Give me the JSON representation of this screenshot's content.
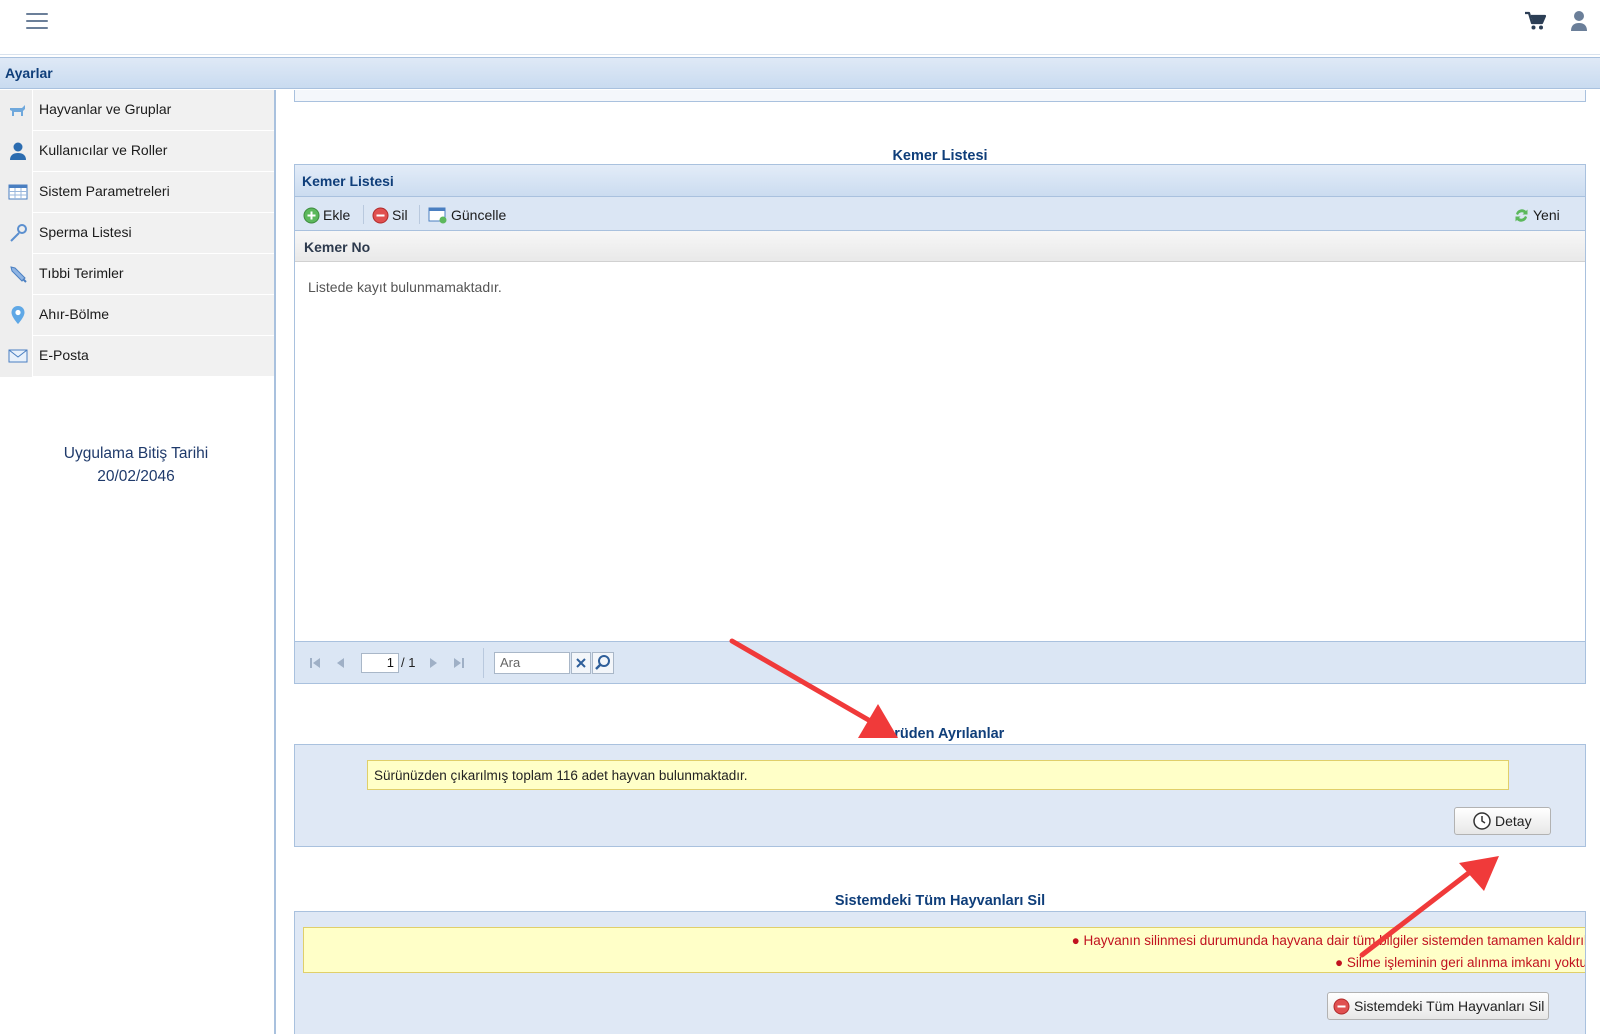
{
  "topbar": {
    "menu_icon": "hamburger-icon",
    "cart_icon": "shopping-cart-icon",
    "user_icon": "user-icon"
  },
  "settings_header": "Ayarlar",
  "sidebar": {
    "items": [
      {
        "label": "Hayvanlar ve Gruplar",
        "icon": "animal-icon"
      },
      {
        "label": "Kullanıcılar ve Roller",
        "icon": "user-icon"
      },
      {
        "label": "Sistem Parametreleri",
        "icon": "table-icon"
      },
      {
        "label": "Sperma Listesi",
        "icon": "pipette-icon"
      },
      {
        "label": "Tıbbi Terimler",
        "icon": "syringe-icon"
      },
      {
        "label": "Ahır-Bölme",
        "icon": "map-pin-icon"
      },
      {
        "label": "E-Posta",
        "icon": "envelope-icon"
      }
    ],
    "expiry_label": "Uygulama Bitiş Tarihi",
    "expiry_date": "20/02/2046"
  },
  "belt_section": {
    "title": "Kemer Listesi",
    "grid_title": "Kemer Listesi",
    "toolbar": {
      "add_label": "Ekle",
      "delete_label": "Sil",
      "update_label": "Güncelle",
      "refresh_label": "Yeni"
    },
    "column_header": "Kemer No",
    "empty_message": "Listede kayıt bulunmamaktadır.",
    "pager": {
      "current_page": "1",
      "total_pages": "/ 1",
      "search_placeholder": "Ara"
    }
  },
  "left_herd_section": {
    "title": "Sürüden Ayrılanlar",
    "message": "Sürünüzden çıkarılmış toplam 116 adet hayvan bulunmaktadır.",
    "detail_button": "Detay"
  },
  "delete_all_section": {
    "title": "Sistemdeki Tüm Hayvanları Sil",
    "warning_1": "Hayvanın silinmesi durumunda hayvana dair tüm bilgiler sistemden tamamen kaldırıl",
    "warning_2": "Silme işleminin geri alınma imkanı yoktu",
    "delete_button": "Sistemdeki Tüm Hayvanları Sil"
  },
  "colors": {
    "accent_dark_blue": "#0f3e7a",
    "panel_blue": "#dfe8f5",
    "notice_yellow": "#ffffc8",
    "warning_red": "#c1121f",
    "annotation_arrow": "#f03a3a"
  }
}
